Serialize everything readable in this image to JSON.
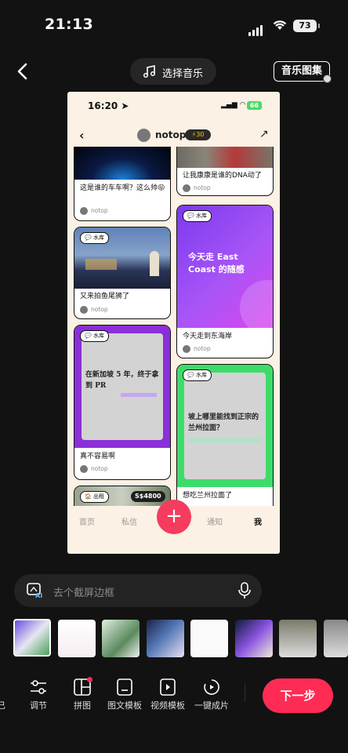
{
  "status": {
    "time": "21:13",
    "battery": "73"
  },
  "topbar": {
    "music_label": "选择音乐",
    "album_label": "音乐图集"
  },
  "preview": {
    "time": "16:20",
    "battery": "66",
    "username": "notop",
    "points": "⚡30",
    "cards": [
      {
        "caption": "这是谁的车车啊？这么帅😝",
        "user": "notop"
      },
      {
        "caption": "让我康康是谁的DNA动了",
        "user": "notop"
      },
      {
        "tag": "水库",
        "caption": "又来拍鱼尾狮了",
        "user": "notop"
      },
      {
        "tag": "水库",
        "overlay": "今天走 East Coast 的随感",
        "caption": "今天走到东海岸",
        "user": "notop"
      },
      {
        "tag": "水库",
        "overlay": "在新加坡 5 年，终于拿到 PR",
        "caption": "真不容易啊",
        "user": "notop"
      },
      {
        "tag": "水库",
        "overlay": "坡上哪里能找到正宗的兰州拉面？",
        "caption": "想吃兰州拉面了"
      },
      {
        "tag": "出租",
        "price": "S$4800"
      }
    ],
    "tabs": [
      "首页",
      "私信",
      "通知",
      "我"
    ],
    "fab": "+"
  },
  "prompt": {
    "placeholder": "去个截屏边框"
  },
  "tools": [
    "调节",
    "拼图",
    "图文模板",
    "视频模板",
    "一键成片"
  ],
  "tool_partial": "已",
  "next_label": "下一步",
  "colors": {
    "accent": "#fe2c55",
    "purple": "#9333ea",
    "green": "#22c55e"
  }
}
